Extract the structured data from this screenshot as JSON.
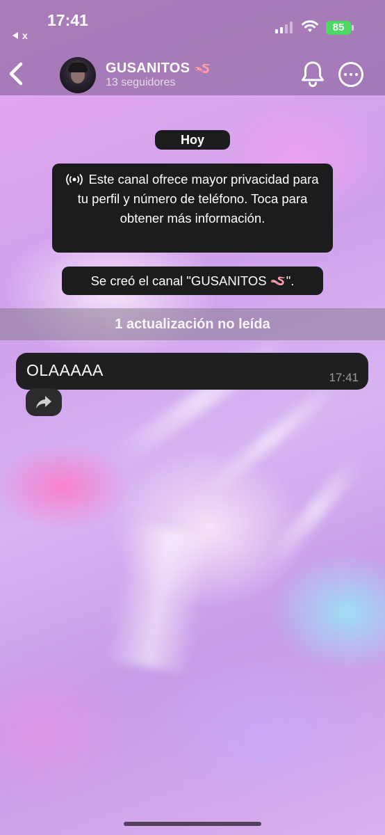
{
  "status_bar": {
    "time": "17:41",
    "back_app_label": "x",
    "battery": "85"
  },
  "header": {
    "channel_name": "GUSANITOS",
    "channel_emoji": "🪱",
    "followers": "13 seguidores",
    "icons": [
      "chevron-left-icon",
      "bell-icon",
      "more-icon"
    ]
  },
  "chat": {
    "date_label": "Hoy",
    "info_text": "Este canal ofrece mayor privacidad para tu perfil y número de teléfono. Toca para obtener más información.",
    "created_text": "Se creó el canal \"GUSANITOS 🪱\".",
    "unread_text": "1 actualización no leída",
    "messages": [
      {
        "text": "OLAAAAA",
        "time": "17:41"
      }
    ]
  },
  "colors": {
    "bubble": "#1f1f21",
    "battery": "#4cd964"
  }
}
